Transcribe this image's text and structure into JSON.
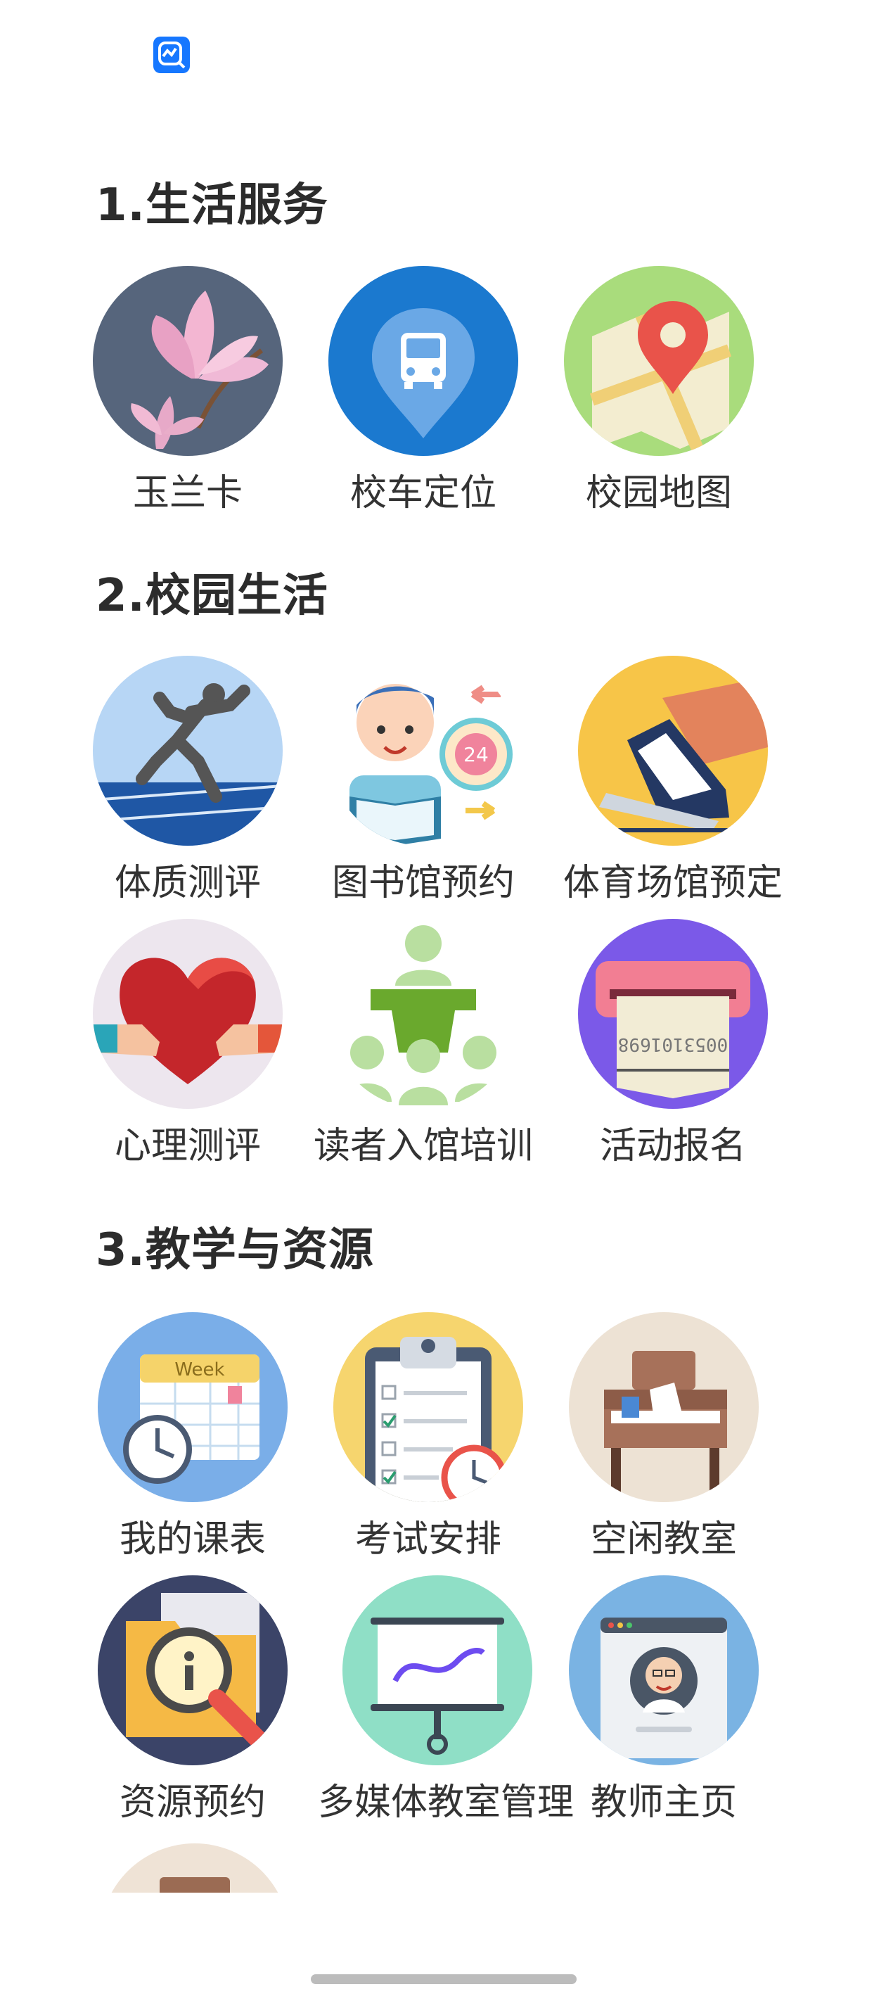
{
  "colors": {
    "status_icon": "#1677ff",
    "home_bar": "#bcbcbc"
  },
  "sections": [
    {
      "title": "1.生活服务",
      "apps": [
        {
          "label": "玉兰卡",
          "icon": "magnolia-flower-icon"
        },
        {
          "label": "校车定位",
          "icon": "bus-location-pin-icon"
        },
        {
          "label": "校园地图",
          "icon": "map-pin-icon"
        }
      ]
    },
    {
      "title": "2.校园生活",
      "apps": [
        {
          "label": "体质测评",
          "icon": "runner-icon"
        },
        {
          "label": "图书馆预约",
          "icon": "reader-clock-icon"
        },
        {
          "label": "体育场馆预定",
          "icon": "sneaker-icon"
        },
        {
          "label": "心理测评",
          "icon": "heart-hands-icon"
        },
        {
          "label": "读者入馆培训",
          "icon": "training-group-icon"
        },
        {
          "label": "活动报名",
          "icon": "ticket-printer-icon"
        }
      ]
    },
    {
      "title": "3.教学与资源",
      "apps": [
        {
          "label": "我的课表",
          "icon": "calendar-clock-icon"
        },
        {
          "label": "考试安排",
          "icon": "clipboard-checklist-icon"
        },
        {
          "label": "空闲教室",
          "icon": "desk-chair-icon"
        },
        {
          "label": "资源预约",
          "icon": "folder-magnifier-icon"
        },
        {
          "label": "多媒体教室管理",
          "icon": "presentation-board-icon"
        },
        {
          "label": "教师主页",
          "icon": "teacher-profile-icon"
        }
      ]
    }
  ],
  "calendar_text": "Week",
  "ticket_text": "0053101698"
}
